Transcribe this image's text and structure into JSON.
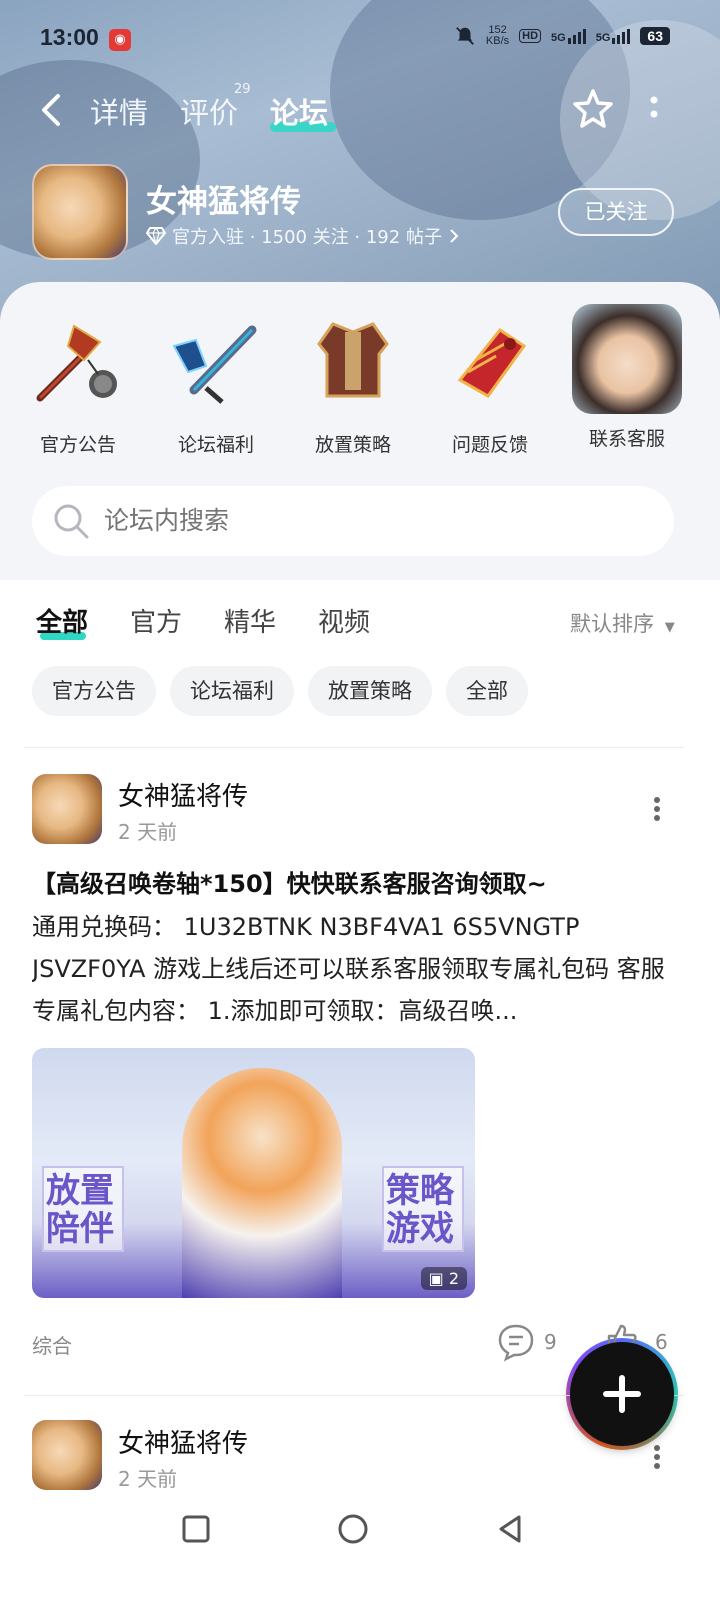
{
  "status_bar": {
    "time": "13:00",
    "net_speed_value": "152",
    "net_speed_unit": "KB/s",
    "hd": "HD",
    "signal1": "5G",
    "signal2": "5G",
    "battery": "63"
  },
  "nav": {
    "tabs": [
      {
        "label": "详情"
      },
      {
        "label": "评价"
      },
      {
        "label": "论坛"
      }
    ],
    "reviews_badge": "29",
    "active_tab": "论坛"
  },
  "game": {
    "title": "女神猛将传",
    "meta": "官方入驻 · 1500 关注 · 192 帖子",
    "follow_label": "已关注"
  },
  "categories": [
    {
      "label": "官方公告",
      "icon": "mace-icon"
    },
    {
      "label": "论坛福利",
      "icon": "sword-icon"
    },
    {
      "label": "放置策略",
      "icon": "armor-icon"
    },
    {
      "label": "问题反馈",
      "icon": "gauntlet-icon"
    },
    {
      "label": "联系客服",
      "icon": "customer-service-avatar"
    }
  ],
  "search": {
    "placeholder": "论坛内搜索"
  },
  "filter_tabs": {
    "tabs": [
      {
        "label": "全部"
      },
      {
        "label": "官方"
      },
      {
        "label": "精华"
      },
      {
        "label": "视频"
      }
    ],
    "sort_label": "默认排序"
  },
  "chips": [
    {
      "label": "官方公告"
    },
    {
      "label": "论坛福利"
    },
    {
      "label": "放置策略"
    },
    {
      "label": "全部"
    }
  ],
  "posts": [
    {
      "author": "女神猛将传",
      "time": "2 天前",
      "title": "【高级召唤卷轴*150】快快联系客服咨询领取~",
      "body": "通用兑换码： 1U32BTNK N3BF4VA1 6S5VNGTP JSVZF0YA 游戏上线后还可以联系客服领取专属礼包码 客服专属礼包内容： 1.添加即可领取：高级召唤...",
      "image_text_left_1": "放置",
      "image_text_left_2": "陪伴",
      "image_text_right_1": "策略",
      "image_text_right_2": "游戏",
      "image_count": "2",
      "tag": "综合",
      "comments": "9",
      "likes": "6"
    },
    {
      "author": "女神猛将传",
      "time": "2 天前"
    }
  ],
  "colors": {
    "accent": "#2fd8c4",
    "header_bg": "#9bb0c7"
  }
}
